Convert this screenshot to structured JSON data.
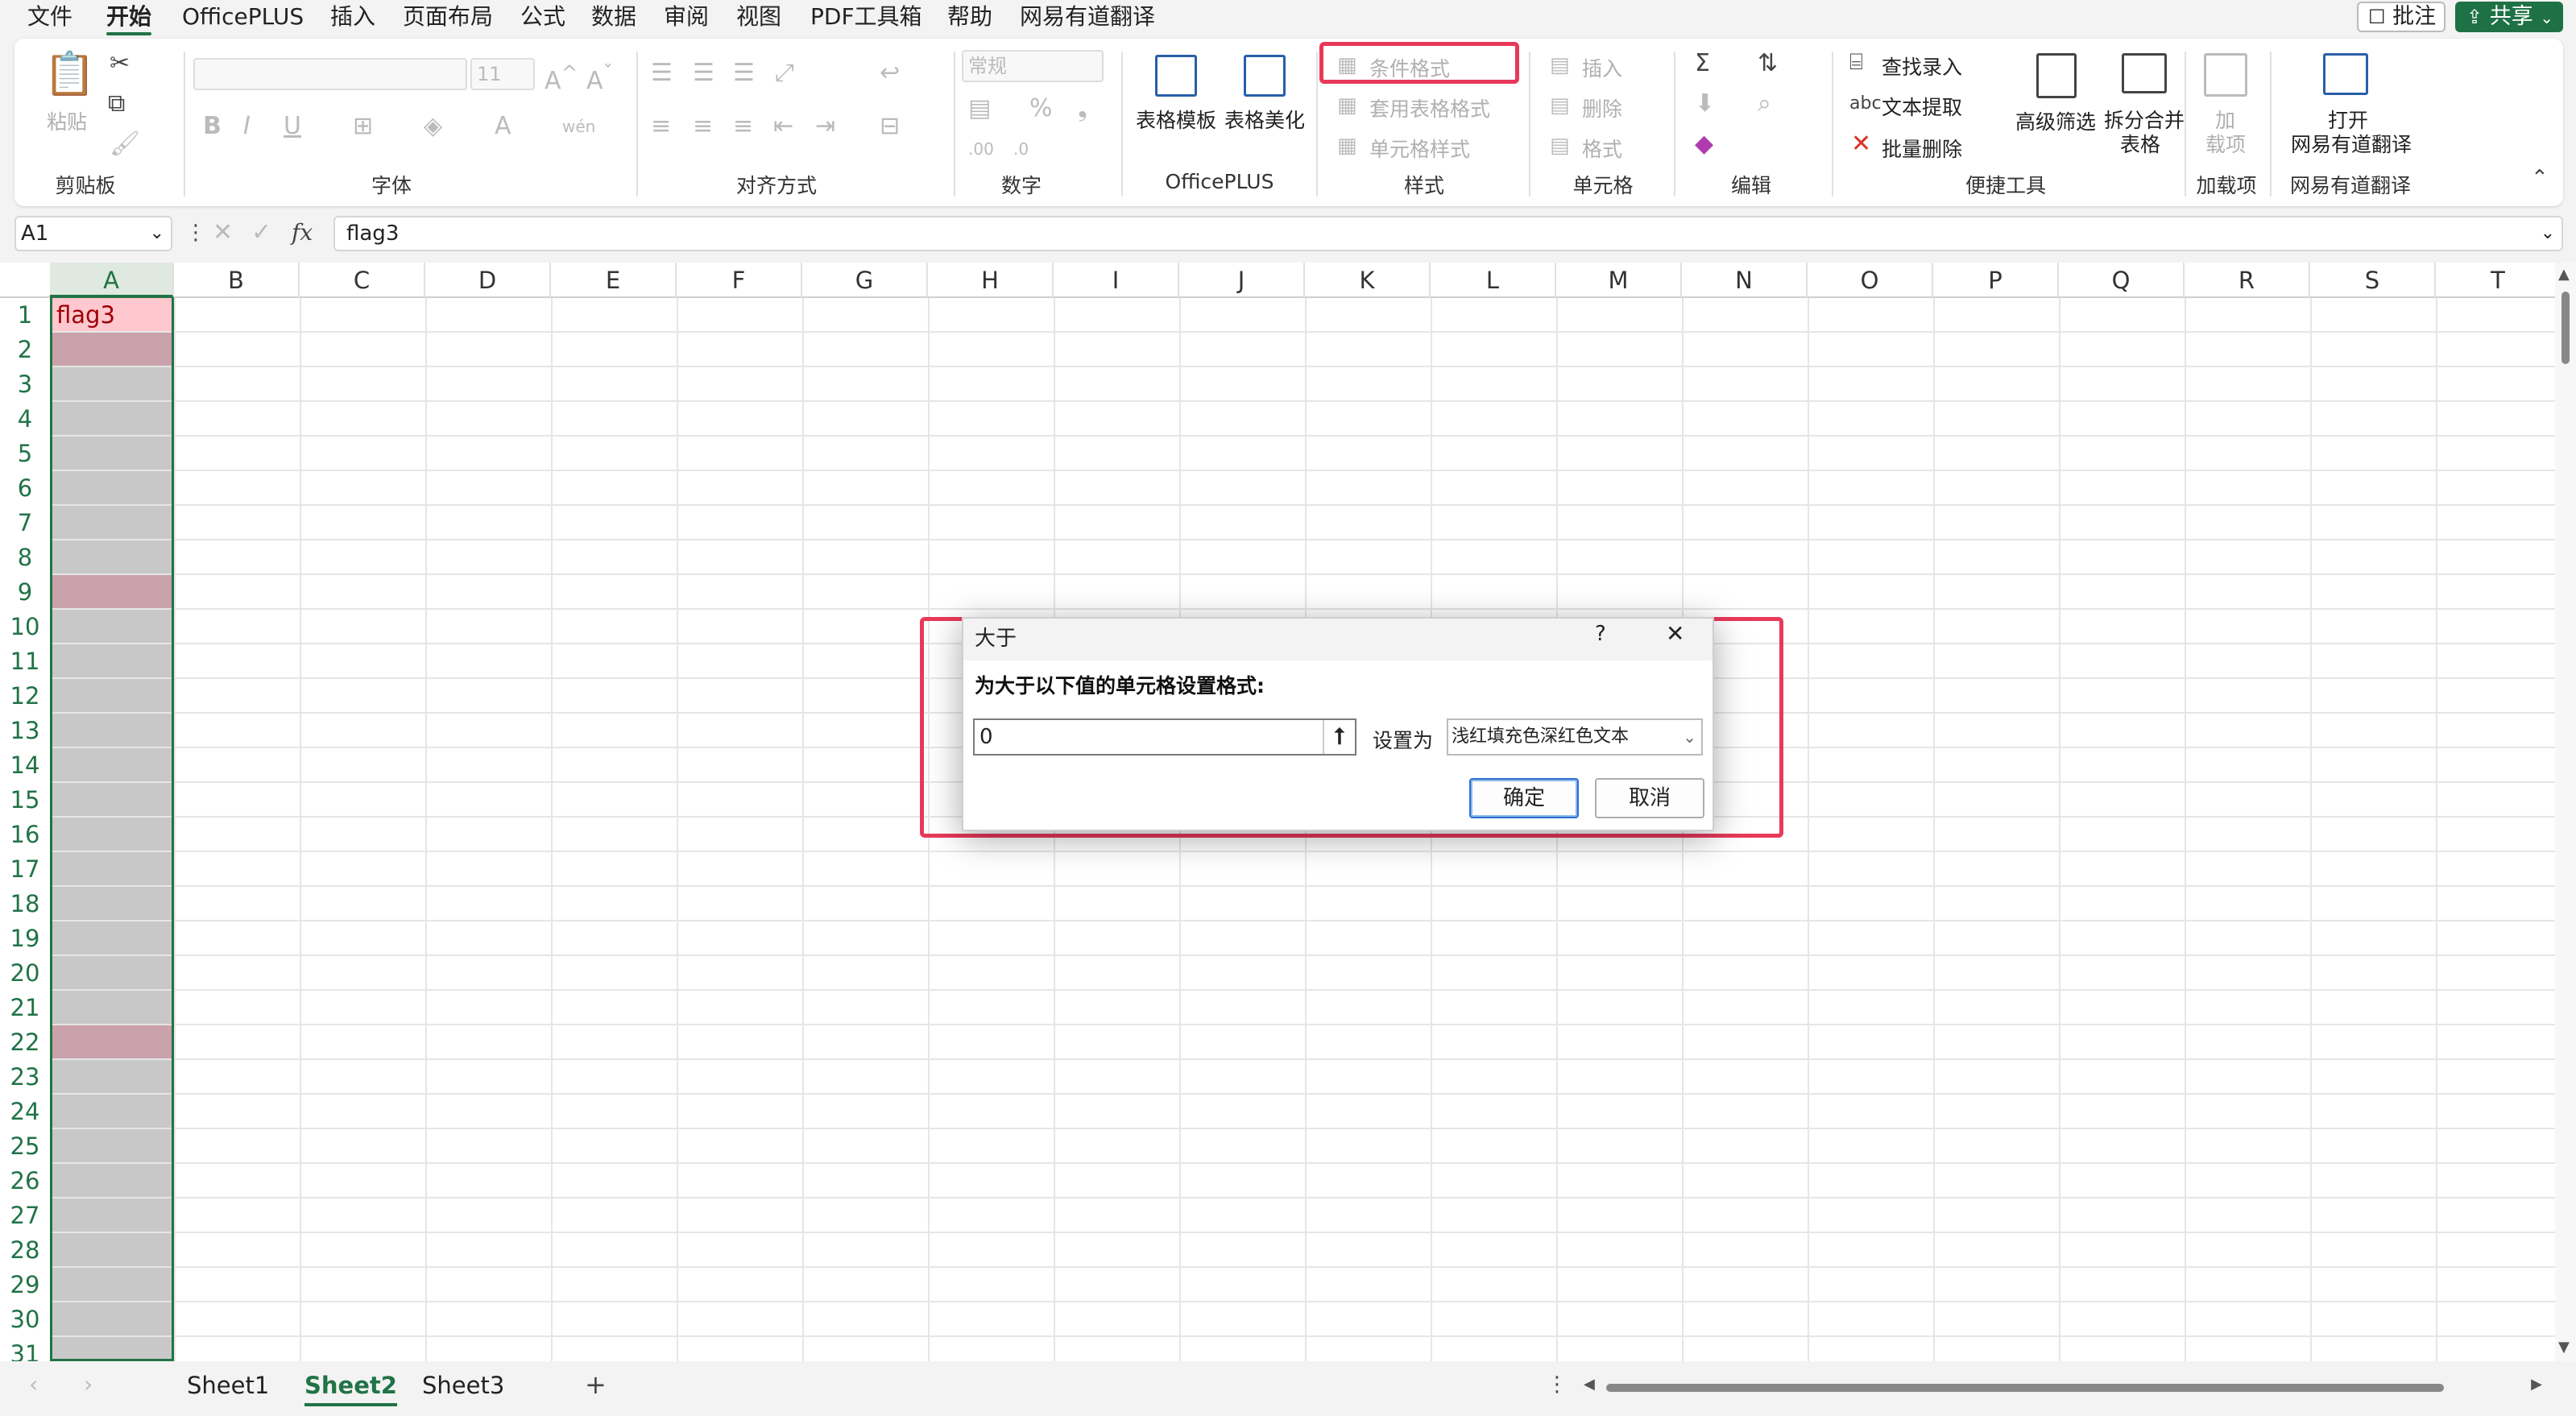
{
  "menu": {
    "items": [
      "文件",
      "开始",
      "OfficePLUS",
      "插入",
      "页面布局",
      "公式",
      "数据",
      "审阅",
      "视图",
      "PDF工具箱",
      "帮助",
      "网易有道翻译"
    ],
    "active": "开始",
    "comment": "批注",
    "share": "共享"
  },
  "ribbon": {
    "clipboard": {
      "paste": "粘贴",
      "label": "剪贴板"
    },
    "font": {
      "name": "",
      "size": "11",
      "bold": "B",
      "italic": "I",
      "underline": "U",
      "label": "字体"
    },
    "alignment": {
      "label": "对齐方式"
    },
    "number": {
      "format": "常规",
      "label": "数字"
    },
    "officeplus": {
      "template": "表格模板",
      "beautify": "表格美化",
      "label": "OfficePLUS"
    },
    "styles": {
      "conditional": "条件格式",
      "table_format": "套用表格格式",
      "cell_style": "单元格样式",
      "label": "样式"
    },
    "cells": {
      "insert": "插入",
      "delete": "删除",
      "format": "格式",
      "label": "单元格"
    },
    "editing": {
      "label": "编辑"
    },
    "tools": {
      "find": "查找录入",
      "extract": "文本提取",
      "batch_delete": "批量删除",
      "adv_filter": "高级筛选",
      "split_merge_1": "拆分合并",
      "split_merge_2": "表格",
      "label": "便捷工具"
    },
    "addins": {
      "line1": "加",
      "line2": "载项",
      "label": "加载项"
    },
    "youdao": {
      "open": "打开",
      "name": "网易有道翻译",
      "label": "网易有道翻译"
    }
  },
  "formula_bar": {
    "cell_ref": "A1",
    "fx": "fx",
    "content": "flag3"
  },
  "grid": {
    "columns": [
      "A",
      "B",
      "C",
      "D",
      "E",
      "F",
      "G",
      "H",
      "I",
      "J",
      "K",
      "L",
      "M",
      "N",
      "O",
      "P",
      "Q",
      "R",
      "S",
      "T"
    ],
    "rows": [
      "1",
      "2",
      "3",
      "4",
      "5",
      "6",
      "7",
      "8",
      "9",
      "10",
      "11",
      "12",
      "13",
      "14",
      "15",
      "16",
      "17",
      "18",
      "19",
      "20",
      "21",
      "22",
      "23",
      "24",
      "25",
      "26",
      "27",
      "28",
      "29",
      "30",
      "31"
    ],
    "cell_A1": "flag3",
    "highlighted_rows": [
      1,
      2,
      9,
      22
    ]
  },
  "sheets": {
    "tabs": [
      "Sheet1",
      "Sheet2",
      "Sheet3"
    ],
    "active": "Sheet2",
    "add": "+"
  },
  "dialog": {
    "title": "大于",
    "help": "?",
    "close": "✕",
    "prompt": "为大于以下值的单元格设置格式:",
    "value": "0",
    "set_as": "设置为",
    "format_option": "浅红填充色深红色文本",
    "ok": "确定",
    "cancel": "取消"
  },
  "colors": {
    "accent": "#217346",
    "highlight_box": "#e8395a",
    "light_red_fill": "#ffc7ce",
    "dark_red_text": "#9c0006"
  }
}
